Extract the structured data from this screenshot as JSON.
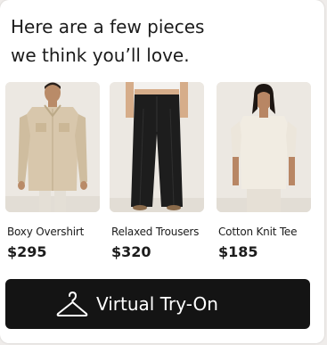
{
  "message": {
    "line1": "Here are a few pieces",
    "line2": "we think you’ll love."
  },
  "products": [
    {
      "name": "Boxy Overshirt",
      "price": "$295",
      "image": "man-in-beige-overshirt"
    },
    {
      "name": "Relaxed Trousers",
      "price": "$320",
      "image": "black-wide-leg-trousers"
    },
    {
      "name": "Cotton Knit Tee",
      "price": "$185",
      "image": "woman-in-cream-knit-tee"
    }
  ],
  "cta": {
    "label": "Virtual Try-On",
    "icon": "hanger-icon"
  },
  "colors": {
    "button_bg": "#141414",
    "text": "#1c1c1c",
    "photo_bg": "#e9e5df"
  }
}
